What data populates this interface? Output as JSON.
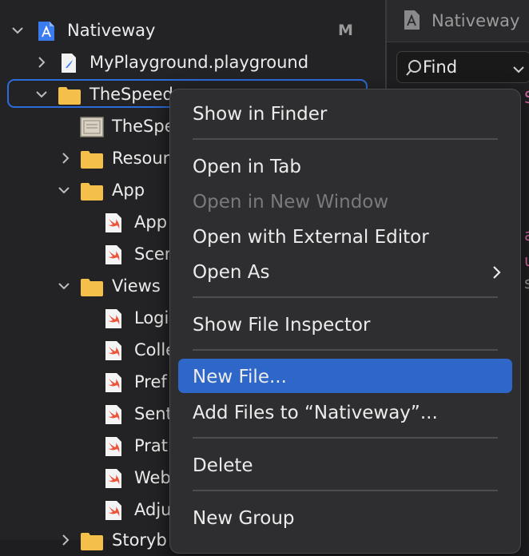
{
  "navigator": {
    "items": [
      {
        "label": "Nativeway",
        "badge": "M",
        "icon": "xcode-project-icon",
        "chevron": "down"
      },
      {
        "label": "MyPlayground.playground",
        "icon": "playground-icon",
        "chevron": "right"
      },
      {
        "label": "TheSpeed",
        "icon": "folder-icon",
        "chevron": "down",
        "selected": true
      },
      {
        "label": "TheSpe",
        "icon": "entitlements-icon",
        "chevron": ""
      },
      {
        "label": "Resour",
        "icon": "folder-icon",
        "chevron": "right"
      },
      {
        "label": "App",
        "icon": "folder-icon",
        "chevron": "down"
      },
      {
        "label": "App",
        "icon": "swift-file-icon",
        "chevron": ""
      },
      {
        "label": "Scen",
        "icon": "swift-file-icon",
        "chevron": ""
      },
      {
        "label": "Views",
        "icon": "folder-icon",
        "chevron": "down"
      },
      {
        "label": "Logi",
        "icon": "swift-file-icon",
        "chevron": ""
      },
      {
        "label": "Colle",
        "icon": "swift-file-icon",
        "chevron": ""
      },
      {
        "label": "Pref",
        "icon": "swift-file-icon",
        "chevron": ""
      },
      {
        "label": "Sent",
        "icon": "swift-file-icon",
        "chevron": ""
      },
      {
        "label": "Prat",
        "icon": "swift-file-icon",
        "chevron": ""
      },
      {
        "label": "Web",
        "icon": "swift-file-icon",
        "chevron": ""
      },
      {
        "label": "Adju",
        "icon": "swift-file-icon",
        "chevron": ""
      },
      {
        "label": "Storyb",
        "icon": "folder-icon",
        "chevron": "right"
      }
    ]
  },
  "editor": {
    "breadcrumb": "Nativeway",
    "find": {
      "label": "Find"
    },
    "code_fragments": [
      "S",
      "a",
      "u",
      "s"
    ]
  },
  "context_menu": {
    "items": [
      {
        "label": "Show in Finder"
      },
      {
        "separator": true
      },
      {
        "label": "Open in Tab"
      },
      {
        "label": "Open in New Window",
        "disabled": true
      },
      {
        "label": "Open with External Editor"
      },
      {
        "label": "Open As",
        "submenu": true
      },
      {
        "separator": true
      },
      {
        "label": "Show File Inspector"
      },
      {
        "separator": true
      },
      {
        "label": "New File...",
        "highlighted": true
      },
      {
        "label": "Add Files to “Nativeway”..."
      },
      {
        "separator": true
      },
      {
        "label": "Delete"
      },
      {
        "separator": true
      },
      {
        "label": "New Group"
      }
    ]
  },
  "colors": {
    "accent": "#2f67c9",
    "folder": "#f5c04a",
    "swift": "#f05138"
  }
}
